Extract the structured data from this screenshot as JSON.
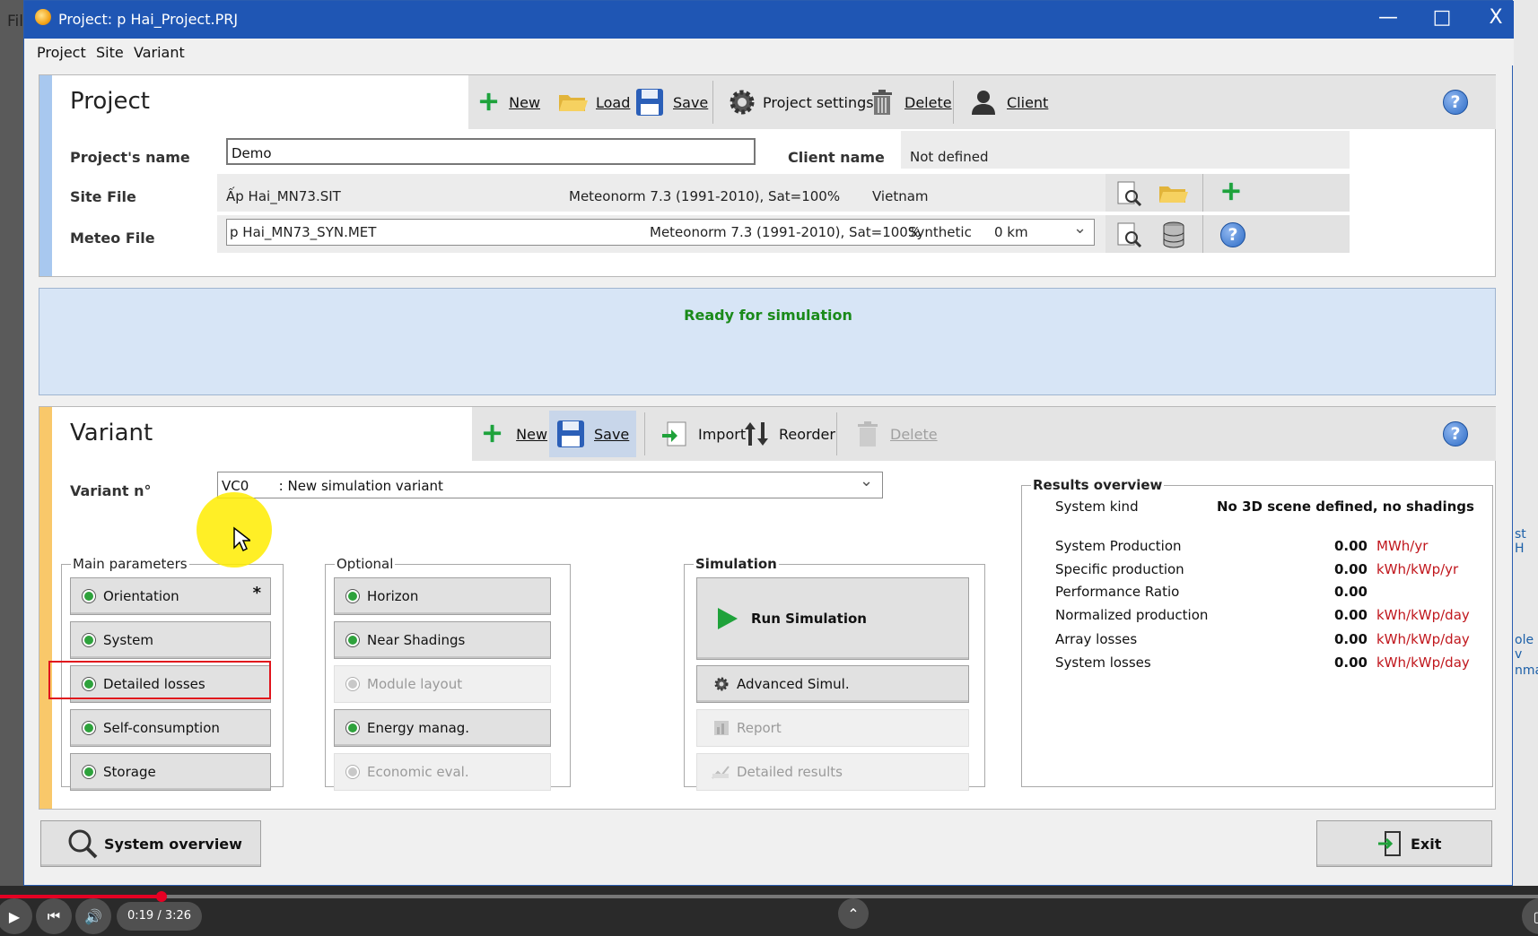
{
  "background": {
    "left_text": "Fil",
    "right_texts": [
      "st H",
      "ole v",
      "nmar"
    ]
  },
  "window": {
    "title": "Project:  p Hai_Project.PRJ",
    "controls": {
      "minimize": "—",
      "maximize": "□",
      "close": "X"
    }
  },
  "menu": [
    "Project",
    "Site",
    "Variant"
  ],
  "project": {
    "title": "Project",
    "toolbar": {
      "new": "New",
      "load": "Load",
      "save": "Save",
      "settings": "Project settings",
      "delete": "Delete",
      "client": "Client"
    },
    "name_label": "Project's name",
    "name_value": "Demo",
    "client_label": "Client name",
    "client_value": "Not defined",
    "site_label": "Site File",
    "site_file": "Ấp Hai_MN73.SIT",
    "site_source": "Meteonorm 7.3 (1991-2010), Sat=100%",
    "site_country": "Vietnam",
    "meteo_label": "Meteo File",
    "meteo_file": "p Hai_MN73_SYN.MET",
    "meteo_source": "Meteonorm 7.3 (1991-2010), Sat=100%",
    "meteo_type": "Synthetic",
    "meteo_dist": "0 km"
  },
  "status": {
    "message": "Ready for simulation",
    "color": "#1a8a1a"
  },
  "variant": {
    "title": "Variant",
    "toolbar": {
      "new": "New",
      "save": "Save",
      "import": "Import",
      "reorder": "Reorder",
      "delete": "Delete"
    },
    "number_label": "Variant n°",
    "select_value": "VC0       : New simulation variant",
    "main_params": {
      "legend": "Main parameters",
      "items": [
        "Orientation",
        "System",
        "Detailed losses",
        "Self-consumption",
        "Storage"
      ],
      "orientation_mark": "*"
    },
    "optional": {
      "legend": "Optional",
      "items": [
        "Horizon",
        "Near Shadings",
        "Module layout",
        "Energy manag.",
        "Economic eval."
      ]
    },
    "simulation": {
      "legend": "Simulation",
      "run": "Run Simulation",
      "advanced": "Advanced Simul.",
      "report": "Report",
      "detailed": "Detailed results"
    },
    "results": {
      "legend": "Results overview",
      "system_kind_label": "System kind",
      "system_kind_value": "No 3D scene defined, no shadings",
      "rows": [
        {
          "label": "System Production",
          "value": "0.00",
          "unit": "MWh/yr"
        },
        {
          "label": "Specific production",
          "value": "0.00",
          "unit": "kWh/kWp/yr"
        },
        {
          "label": "Performance Ratio",
          "value": "0.00",
          "unit": ""
        },
        {
          "label": "Normalized production",
          "value": "0.00",
          "unit": "kWh/kWp/day"
        },
        {
          "label": "Array losses",
          "value": "0.00",
          "unit": "kWh/kWp/day"
        },
        {
          "label": "System losses",
          "value": "0.00",
          "unit": "kWh/kWp/day"
        }
      ]
    }
  },
  "bottom": {
    "system_overview": "System overview",
    "exit": "Exit"
  },
  "video": {
    "time": "0:19 / 3:26",
    "progress": 0.105
  }
}
